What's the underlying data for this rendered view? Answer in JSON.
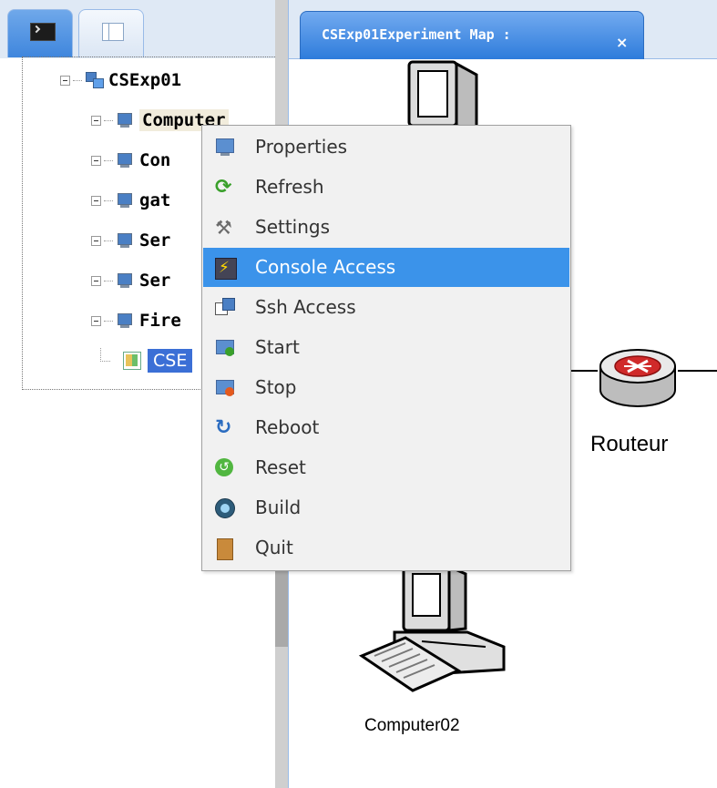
{
  "left_panel": {
    "tree": [
      {
        "label": "CSExp01",
        "icon": "network-icon"
      },
      {
        "label": "Computer",
        "icon": "computer-icon"
      },
      {
        "label": "Con",
        "icon": "computer-icon"
      },
      {
        "label": "gat",
        "icon": "computer-icon"
      },
      {
        "label": "Ser",
        "icon": "computer-icon"
      },
      {
        "label": "Ser",
        "icon": "computer-icon"
      },
      {
        "label": "Fire",
        "icon": "computer-icon"
      },
      {
        "label": "CSE",
        "icon": "map-icon"
      }
    ]
  },
  "right_panel": {
    "tab_title": "CSExp01Experiment Map :",
    "canvas": {
      "router_label": "Routeur",
      "computer02_label": "Computer02"
    }
  },
  "context_menu": {
    "active_item": "Console Access",
    "items": [
      {
        "label": "Properties",
        "icon": "properties-icon"
      },
      {
        "label": "Refresh",
        "icon": "refresh-icon"
      },
      {
        "label": "Settings",
        "icon": "settings-icon"
      },
      {
        "label": "Console Access",
        "icon": "console-icon"
      },
      {
        "label": "Ssh Access",
        "icon": "ssh-icon"
      },
      {
        "label": "Start",
        "icon": "start-icon"
      },
      {
        "label": "Stop",
        "icon": "stop-icon"
      },
      {
        "label": "Reboot",
        "icon": "reboot-icon"
      },
      {
        "label": "Reset",
        "icon": "reset-icon"
      },
      {
        "label": "Build",
        "icon": "build-icon"
      },
      {
        "label": "Quit",
        "icon": "quit-icon"
      }
    ]
  },
  "colors": {
    "menu_highlight": "#3b93ea",
    "tab_blue": "#3f86dd",
    "selected_node": "#3b6fd6",
    "hover_node": "#f1ecdc"
  }
}
